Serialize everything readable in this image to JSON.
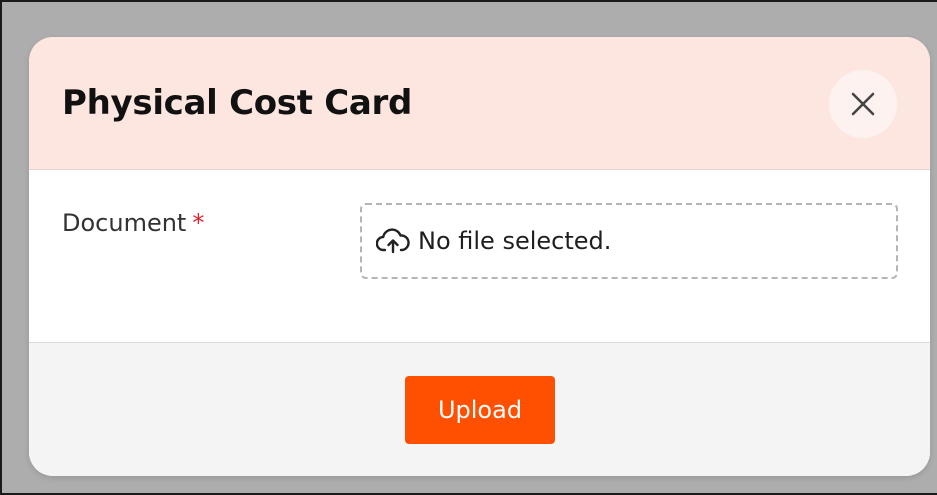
{
  "modal": {
    "title": "Physical Cost Card",
    "close_icon": "close-icon"
  },
  "form": {
    "document_label": "Document",
    "required_marker": "*",
    "file_status": "No file selected.",
    "upload_icon": "cloud-upload-icon"
  },
  "footer": {
    "upload_label": "Upload"
  },
  "colors": {
    "header_bg": "#fde6df",
    "accent": "#ff4f00",
    "required": "#e5202e",
    "backdrop": "#adadad"
  }
}
